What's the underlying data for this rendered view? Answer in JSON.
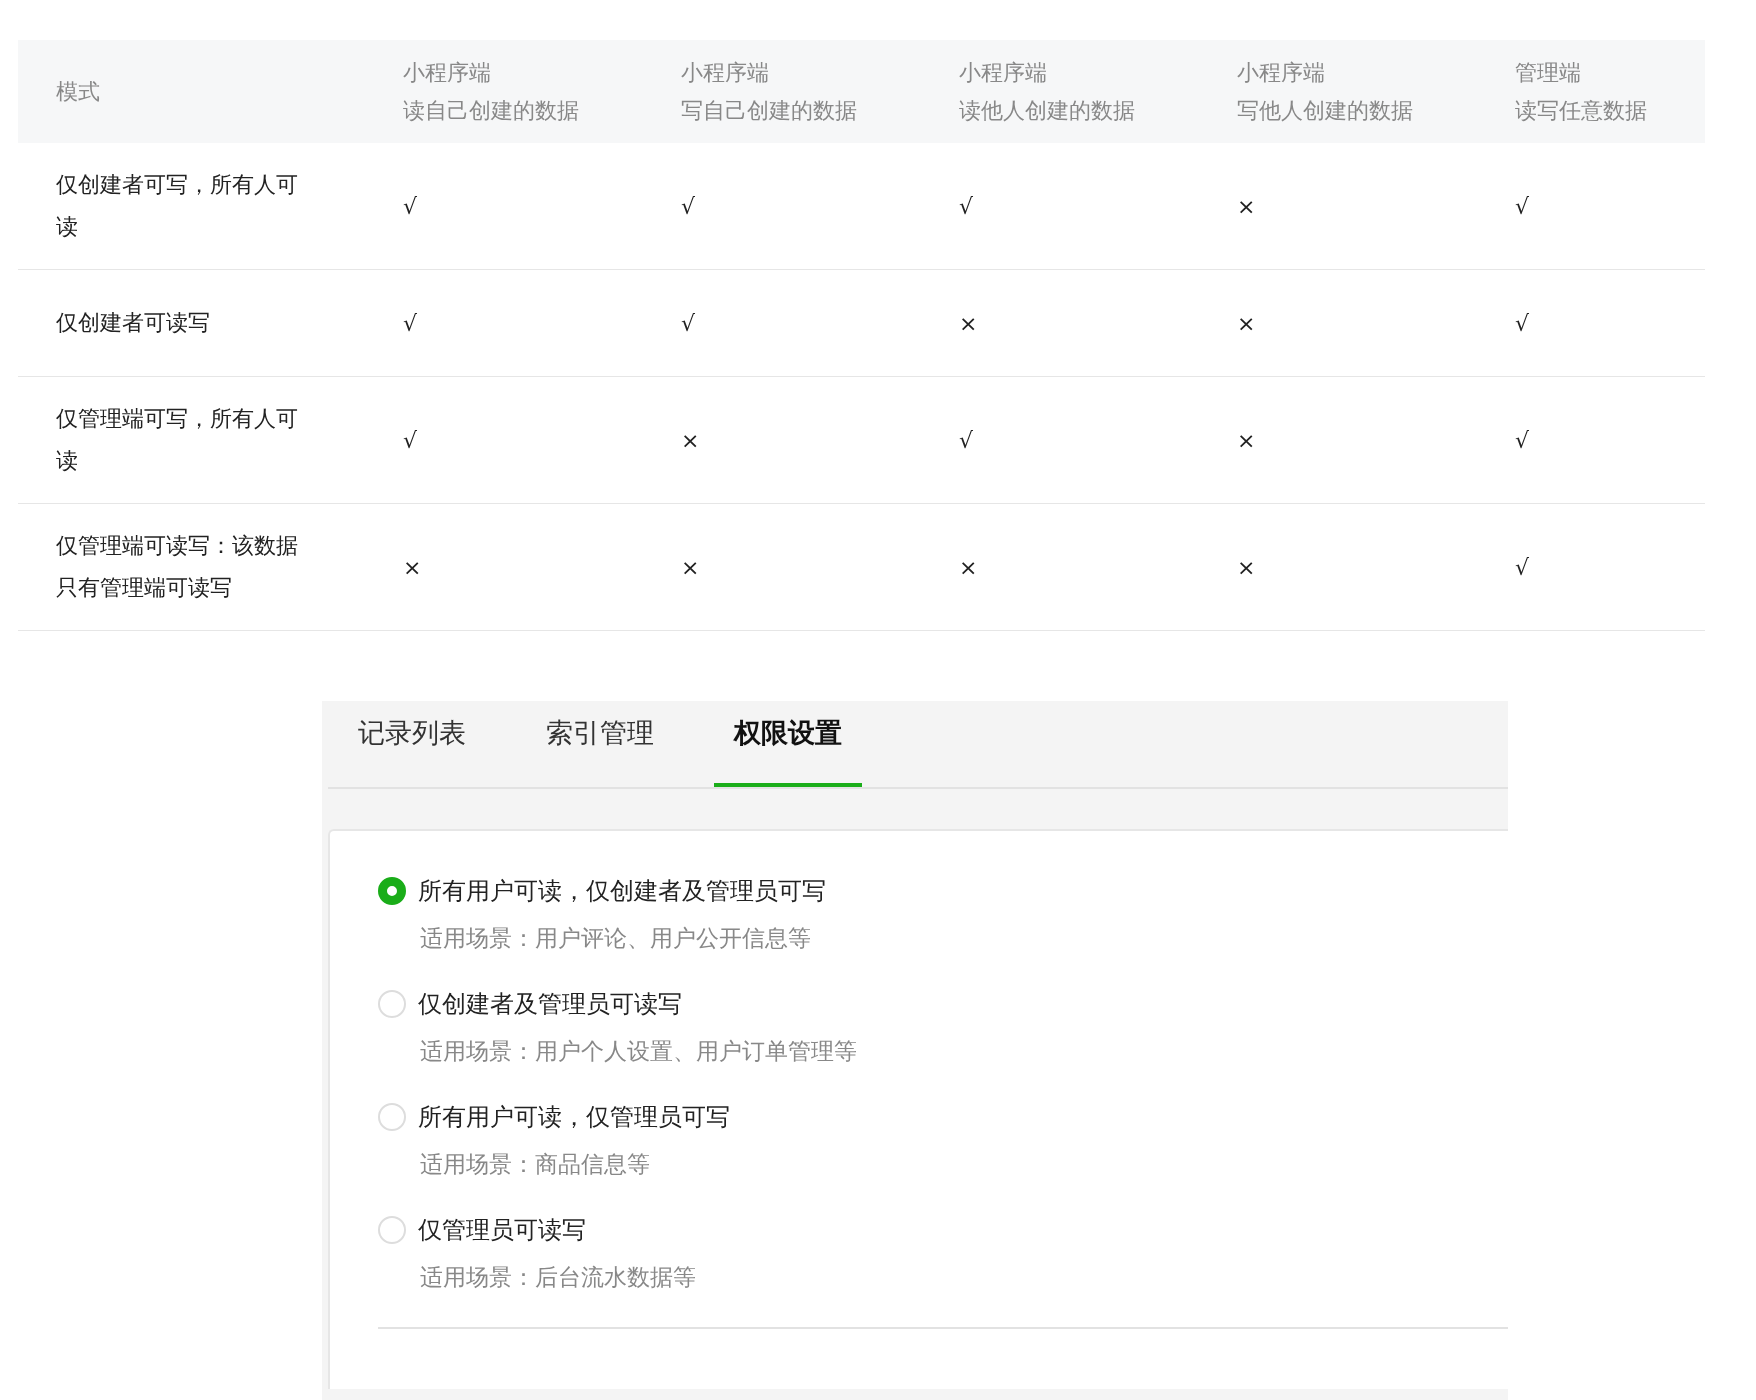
{
  "table": {
    "columns": [
      {
        "lines": [
          "模式"
        ]
      },
      {
        "lines": [
          "小程序端",
          "读自己创建的数据"
        ]
      },
      {
        "lines": [
          "小程序端",
          "写自己创建的数据"
        ]
      },
      {
        "lines": [
          "小程序端",
          "读他人创建的数据"
        ]
      },
      {
        "lines": [
          "小程序端",
          "写他人创建的数据"
        ]
      },
      {
        "lines": [
          "管理端",
          "读写任意数据"
        ]
      }
    ],
    "rows": [
      {
        "cells": [
          "仅创建者可写，所有人可读",
          "√",
          "√",
          "√",
          "×",
          "√"
        ]
      },
      {
        "cells": [
          "仅创建者可读写",
          "√",
          "√",
          "×",
          "×",
          "√"
        ]
      },
      {
        "cells": [
          "仅管理端可写，所有人可读",
          "√",
          "×",
          "√",
          "×",
          "√"
        ]
      },
      {
        "cells": [
          "仅管理端可读写：该数据只有管理端可读写",
          "×",
          "×",
          "×",
          "×",
          "√"
        ]
      }
    ]
  },
  "tabs": [
    {
      "label": "记录列表",
      "selected": false
    },
    {
      "label": "索引管理",
      "selected": false
    },
    {
      "label": "权限设置",
      "selected": true
    }
  ],
  "options": [
    {
      "label": "所有用户可读，仅创建者及管理员可写",
      "hint": "适用场景：用户评论、用户公开信息等",
      "selected": true
    },
    {
      "label": "仅创建者及管理员可读写",
      "hint": "适用场景：用户个人设置、用户订单管理等",
      "selected": false
    },
    {
      "label": "所有用户可读，仅管理员可写",
      "hint": "适用场景：商品信息等",
      "selected": false
    },
    {
      "label": "仅管理员可读写",
      "hint": "适用场景：后台流水数据等",
      "selected": false
    }
  ]
}
